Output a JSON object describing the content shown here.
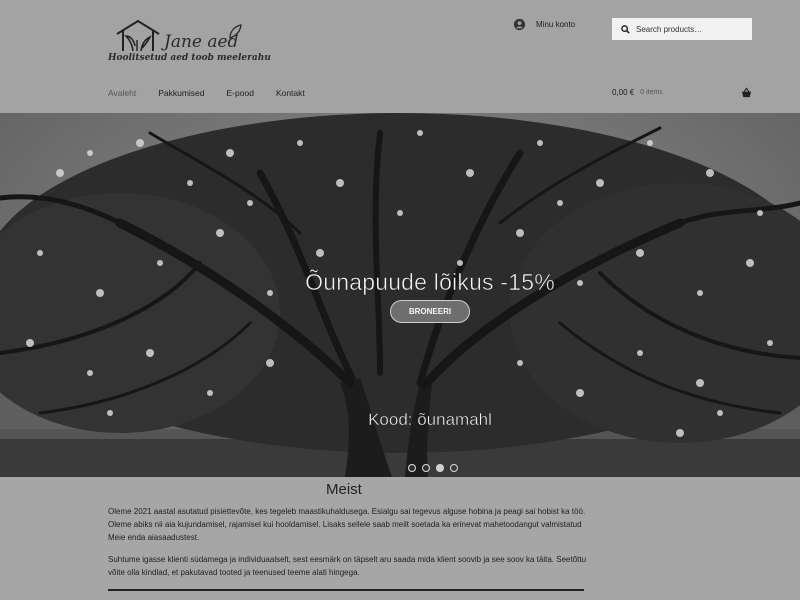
{
  "brand": {
    "name": "Jane aed",
    "tagline": "Hoolitsetud aed toob meelerahu"
  },
  "header": {
    "account_label": "Minu konto",
    "search_placeholder": "Search products…"
  },
  "nav": {
    "items": [
      {
        "label": "Avaleht",
        "active": true
      },
      {
        "label": "Pakkumised",
        "active": false
      },
      {
        "label": "E-pood",
        "active": false
      },
      {
        "label": "Kontakt",
        "active": false
      }
    ]
  },
  "cart": {
    "total": "0,00 €",
    "count": "0 items"
  },
  "hero": {
    "title": "Õunapuude lõikus -15%",
    "button_label": "BRONEERI",
    "code_text": "Kood: õunamahl",
    "slides": 4,
    "active_slide": 2
  },
  "about": {
    "heading": "Meist",
    "paragraph1": "Oleme 2021 aastal asutatud pisiettevõte, kes tegeleb maastikuhaldusega. Esialgu sai tegevus alguse hobina ja peagi sai hobist ka töö. Oleme abiks nii aia kujundamisel, rajamisel kui hooldamisel. Lisaks sellele saab meilt soetada ka erinevat mahetoodangut valmistatud Meie enda aiasaadustest.",
    "paragraph2": "Suhtume igasse klienti südamega ja individuaalselt, sest eesmärk on täpselt aru saada mida klient soovib ja see soov ka täita. Seetõttu võite olla kindlad, et pakutavad tooted ja teenused teeme alati hingega."
  },
  "colors": {
    "page_bg": "#a6a6a6",
    "search_bg": "#f1f1f1",
    "hero_text": "#f2f2f2"
  }
}
